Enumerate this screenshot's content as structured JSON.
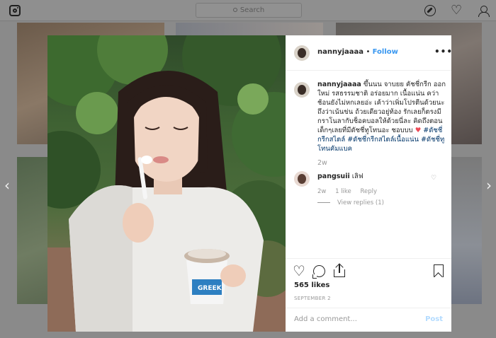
{
  "nav": {
    "logo_icon": "instagram-icon",
    "search_placeholder": "Search",
    "icons": [
      "compass-icon",
      "heart-icon",
      "user-icon"
    ]
  },
  "post": {
    "username": "nannyjaaaa",
    "follow_label": "Follow",
    "more_label": "•••",
    "caption": {
      "username": "nannyjaaaa",
      "text": "ขึ้นนน จาบยย คัชชี่กรีก ออกใหม่ รสธรรมชาติ อร่อยมาก เนื้อแน่น คว่าช้อนยังไม่หกเลยอ่ะ เค้าว่าเพิ่มโปรตีนด้วยนะ ถึงว่าเน้นข่น ถ้วยเดียวอยู่ท้อง รักเลยก็ตรงมี กราโนลากับช็อคบอลให้ด้วยนี่ละ คิดถึงตอนเด็กๆเลยที่มีดัชชี่ทูโทนอะ ชอบบบ",
      "tags": "#ดัชชี่กรีกสไตล์ #ดัชชี่กรีกสไตล์เนื้อแน่น #ดัชชี่ทูโทนคัมแบค",
      "time": "2w"
    },
    "comment": {
      "username": "pangsuii",
      "text": "เลิฟ",
      "time": "2w",
      "likes": "1 like",
      "reply_label": "Reply",
      "view_replies": "View replies (1)"
    },
    "likes": "565 likes",
    "date": "SEPTEMBER 2",
    "add_comment_placeholder": "Add a comment...",
    "post_label": "Post"
  },
  "navigation": {
    "prev_arrow": "‹",
    "next_arrow": "›"
  },
  "colors": {
    "accent": "#3897f0",
    "heart_red": "#ed4956",
    "overlay": "#8a8a8a"
  }
}
